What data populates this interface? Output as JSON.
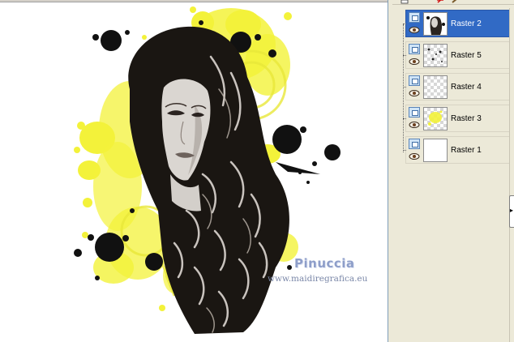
{
  "watermark": {
    "title": "Pinuccia",
    "url": "www.maidiregrafica.eu"
  },
  "toolbar": {
    "icons": [
      "new-layer-icon",
      "delete-icon",
      "brush-icon"
    ],
    "delete_color": "#d01010"
  },
  "layers": [
    {
      "label": "Raster 2",
      "selected": true,
      "thumbnail": "portrait-icon"
    },
    {
      "label": "Raster 5",
      "selected": false,
      "thumbnail": "splatter-icon"
    },
    {
      "label": "Raster 4",
      "selected": false,
      "thumbnail": "transparent-icon"
    },
    {
      "label": "Raster 3",
      "selected": false,
      "thumbnail": "yellow-splash-icon"
    },
    {
      "label": "Raster 1",
      "selected": false,
      "thumbnail": "white-fill-icon"
    }
  ],
  "colors": {
    "selection": "#316ac5",
    "panel_bg": "#ece9d8",
    "splash_yellow": "#f3f23a",
    "ink": "#111111"
  }
}
